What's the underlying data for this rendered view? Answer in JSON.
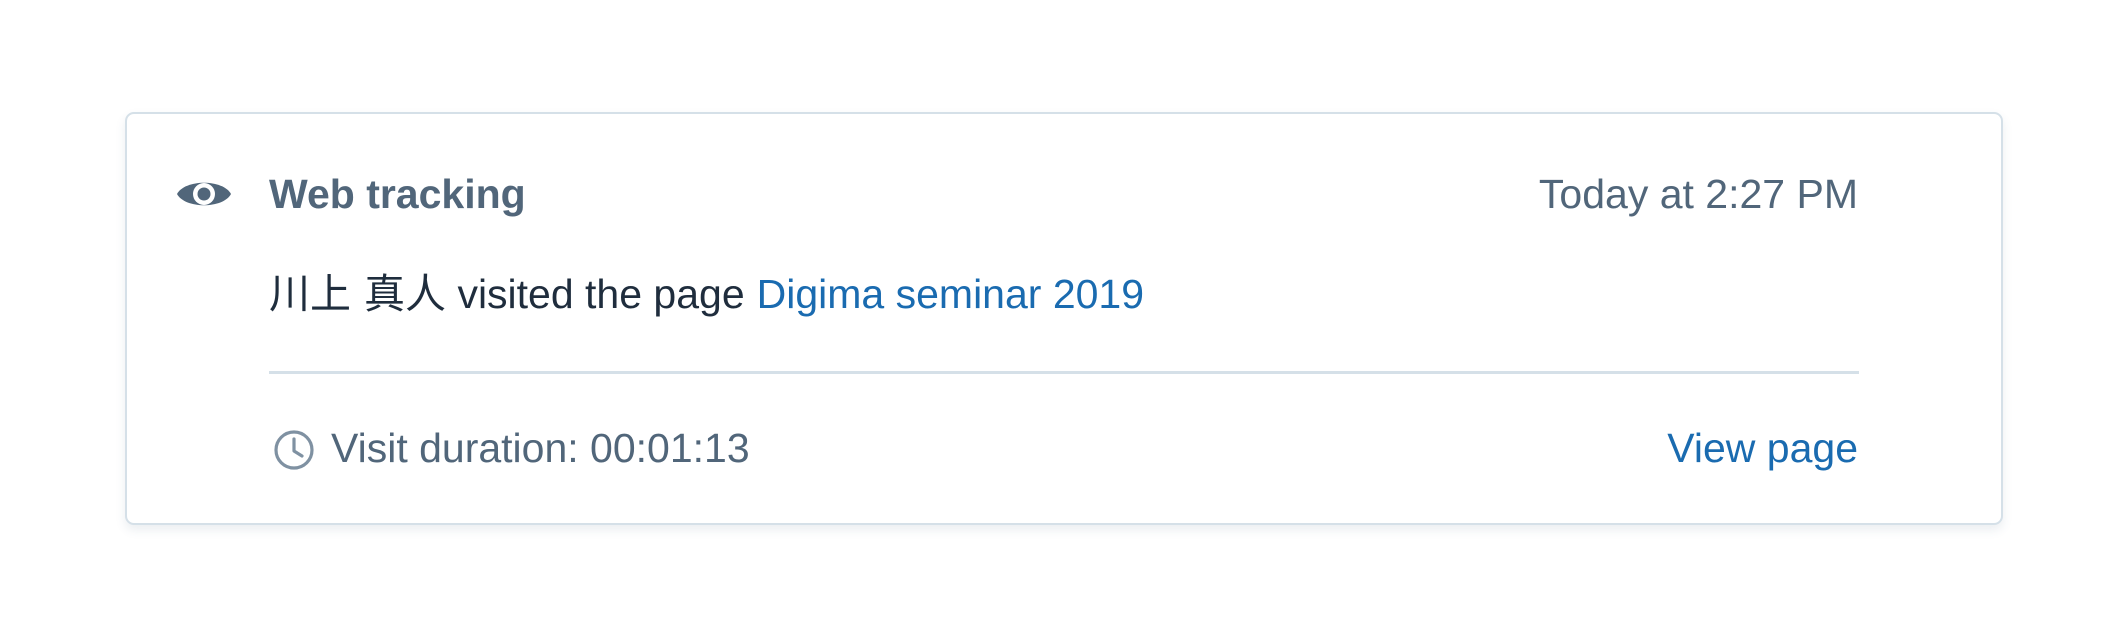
{
  "activity": {
    "icon": "eye-icon",
    "type_label": "Web tracking",
    "timestamp": "Today at 2:27 PM",
    "person_name": "川上 真人",
    "action_text": " visited the page",
    "page_title": "Digima seminar 2019",
    "duration_icon": "clock-icon",
    "duration_text": "Visit duration: 00:01:13",
    "view_page_label": "View page"
  },
  "colors": {
    "muted_text": "#51667a",
    "link": "#1a6bb0",
    "body_text": "#1f2d3d",
    "border": "#d5e0e8"
  }
}
